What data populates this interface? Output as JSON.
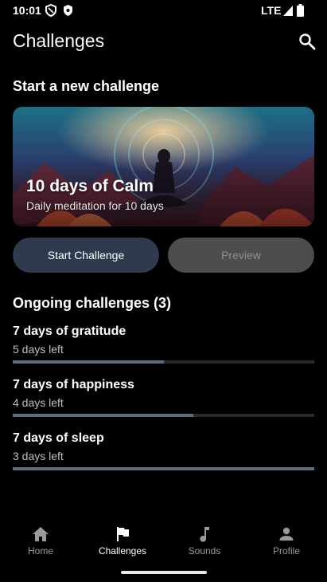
{
  "status_bar": {
    "time": "10:01",
    "network": "LTE"
  },
  "app_bar": {
    "title": "Challenges",
    "search_icon": "search-icon"
  },
  "new_challenge": {
    "section_title": "Start a new challenge",
    "card": {
      "title": "10 days of Calm",
      "subtitle": "Daily meditation for 10 days"
    },
    "start_label": "Start Challenge",
    "preview_label": "Preview"
  },
  "ongoing": {
    "section_title": "Ongoing challenges (3)",
    "items": [
      {
        "title": "7 days of gratitude",
        "subtitle": "5 days left",
        "progress": 0.5
      },
      {
        "title": "7 days of happiness",
        "subtitle": "4 days left",
        "progress": 0.6
      },
      {
        "title": "7 days of sleep",
        "subtitle": "3 days left",
        "progress": 1.0
      }
    ]
  },
  "bottom_nav": [
    {
      "label": "Home",
      "icon": "home-icon",
      "active": false
    },
    {
      "label": "Challenges",
      "icon": "flag-icon",
      "active": true
    },
    {
      "label": "Sounds",
      "icon": "music-note-icon",
      "active": false
    },
    {
      "label": "Profile",
      "icon": "person-icon",
      "active": false
    }
  ],
  "colors": {
    "background": "#000000",
    "accent": "#5b6e80",
    "button_primary": "#2f3a4e",
    "button_disabled": "#4d4d4d"
  }
}
